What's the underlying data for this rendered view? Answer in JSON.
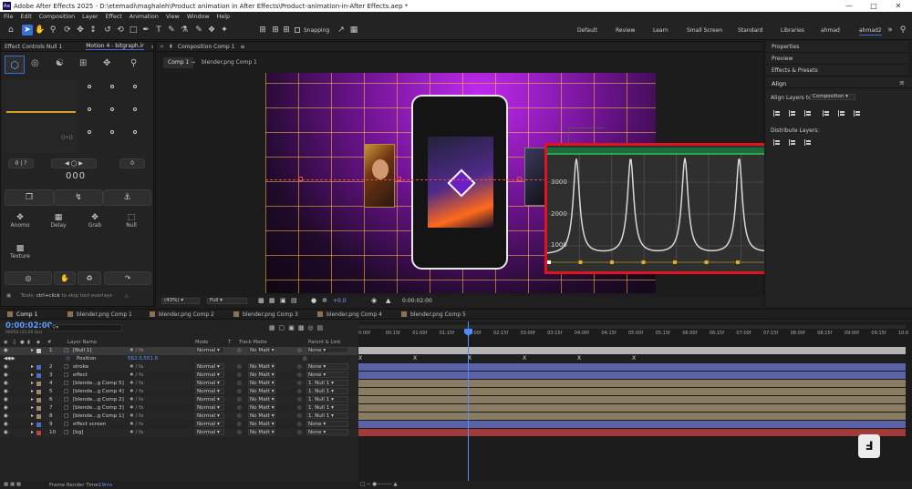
{
  "window": {
    "title": "Adobe After Effects 2025 - D:\\etemadi\\maghaleh\\Product animation in After Effects\\Product-animation-in-After Effects.aep *",
    "app_icon": "Ae"
  },
  "menu": [
    "File",
    "Edit",
    "Composition",
    "Layer",
    "Effect",
    "Animation",
    "View",
    "Window",
    "Help"
  ],
  "toolbar": {
    "snapping_label": "Snapping",
    "snapping_checked": false
  },
  "workspaces": [
    "Default",
    "Review",
    "Learn",
    "Small Screen",
    "Standard",
    "Libraries",
    "ahmad",
    "ahmad2"
  ],
  "workspace_active": "ahmad2",
  "effect_controls": {
    "title": "Effect Controls Null 1",
    "motion_tab": "Motion 4 - bitgraph.ir"
  },
  "motion": {
    "fields": [
      "0",
      "?",
      "0"
    ],
    "readout": "000",
    "tools": [
      "Anomo",
      "Delay",
      "Grab",
      "Null",
      "Texture"
    ],
    "hint_prefix": "Tools:",
    "hint_key": "ctrl+click",
    "hint_suffix": " to skip tool overlays"
  },
  "composition": {
    "panel_title": "Composition Comp 1",
    "tab": "Comp 1",
    "breadcrumb": "blender.png Comp 1",
    "zoom": "(43%)",
    "resolution": "Full",
    "exposure": "+0.0",
    "timecode": "0:00:02:00"
  },
  "graph_overlay": {
    "y_labels": [
      "3000",
      "2000",
      "1000"
    ],
    "spikes": 6
  },
  "right_panels": {
    "tabs": [
      "Properties",
      "Preview",
      "Effects & Presets"
    ],
    "align": {
      "title": "Align",
      "align_to_label": "Align Layers to:",
      "align_to_value": "Composition",
      "distribute_label": "Distribute Layers:"
    }
  },
  "timeline": {
    "tabs": [
      "Comp 1",
      "blender.png Comp 1",
      "blender.png Comp 2",
      "blender.png Comp 3",
      "blender.png Comp 4",
      "blender.png Comp 5"
    ],
    "timecode": "0:00:02:00",
    "timecode_sub": "00050 (25.00 fps)",
    "headers": {
      "layer_name": "Layer Name",
      "mode": "Mode",
      "t": "T",
      "track_matte": "Track Matte",
      "parent": "Parent & Link"
    },
    "ruler": [
      "0:00f",
      "00:15f",
      "01:00f",
      "01:15f",
      "02:00f",
      "02:15f",
      "03:00f",
      "03:15f",
      "04:00f",
      "04:15f",
      "05:00f",
      "05:15f",
      "06:00f",
      "06:15f",
      "07:00f",
      "07:15f",
      "08:00f",
      "08:15f",
      "09:00f",
      "09:15f",
      "10:0"
    ],
    "position_label": "Position",
    "position_value": "562.0,551.6",
    "layers": [
      {
        "num": "1",
        "name": "[Null 1]",
        "mode": "Normal",
        "matte": "No Matt",
        "parent": "None",
        "color": "#c8c8c8",
        "bar": "#b4b4b4"
      },
      {
        "num": "2",
        "name": "stroke",
        "mode": "Normal",
        "matte": "No Matt",
        "parent": "None",
        "color": "#4f6fc4",
        "bar": "#5a62a8"
      },
      {
        "num": "3",
        "name": "effect",
        "mode": "Normal",
        "matte": "No Matt",
        "parent": "None",
        "color": "#4f6fc4",
        "bar": "#5a62a8"
      },
      {
        "num": "4",
        "name": "[blende...g Comp 5]",
        "mode": "Normal",
        "matte": "No Matt",
        "parent": "1. Null 1",
        "color": "#a3886a",
        "bar": "#8a7b63"
      },
      {
        "num": "5",
        "name": "[blende...g Comp 4]",
        "mode": "Normal",
        "matte": "No Matt",
        "parent": "1. Null 1",
        "color": "#a3886a",
        "bar": "#8a7b63"
      },
      {
        "num": "6",
        "name": "[blende...g Comp 2]",
        "mode": "Normal",
        "matte": "No Matt",
        "parent": "1. Null 1",
        "color": "#a3886a",
        "bar": "#8a7b63"
      },
      {
        "num": "7",
        "name": "[blende...g Comp 3]",
        "mode": "Normal",
        "matte": "No Matt",
        "parent": "1. Null 1",
        "color": "#a3886a",
        "bar": "#8a7b63"
      },
      {
        "num": "8",
        "name": "[blende...g Comp 1]",
        "mode": "Normal",
        "matte": "No Matt",
        "parent": "1. Null 1",
        "color": "#a3886a",
        "bar": "#8a7b63"
      },
      {
        "num": "9",
        "name": "effect screen",
        "mode": "Normal",
        "matte": "No Matt",
        "parent": "None",
        "color": "#4f6fc4",
        "bar": "#5a62a8"
      },
      {
        "num": "10",
        "name": "[bg]",
        "mode": "Normal",
        "matte": "No Matt",
        "parent": "None",
        "color": "#c0453a",
        "bar": "#a33a3a"
      }
    ],
    "frame_render_label": "Frame Render Time:",
    "frame_render_value": "19ms"
  },
  "colors": {
    "accent": "#3a6fd8",
    "highlight_box": "#e0141e",
    "playhead": "#4e8cff",
    "comp_bg": "#7a1f9e"
  }
}
